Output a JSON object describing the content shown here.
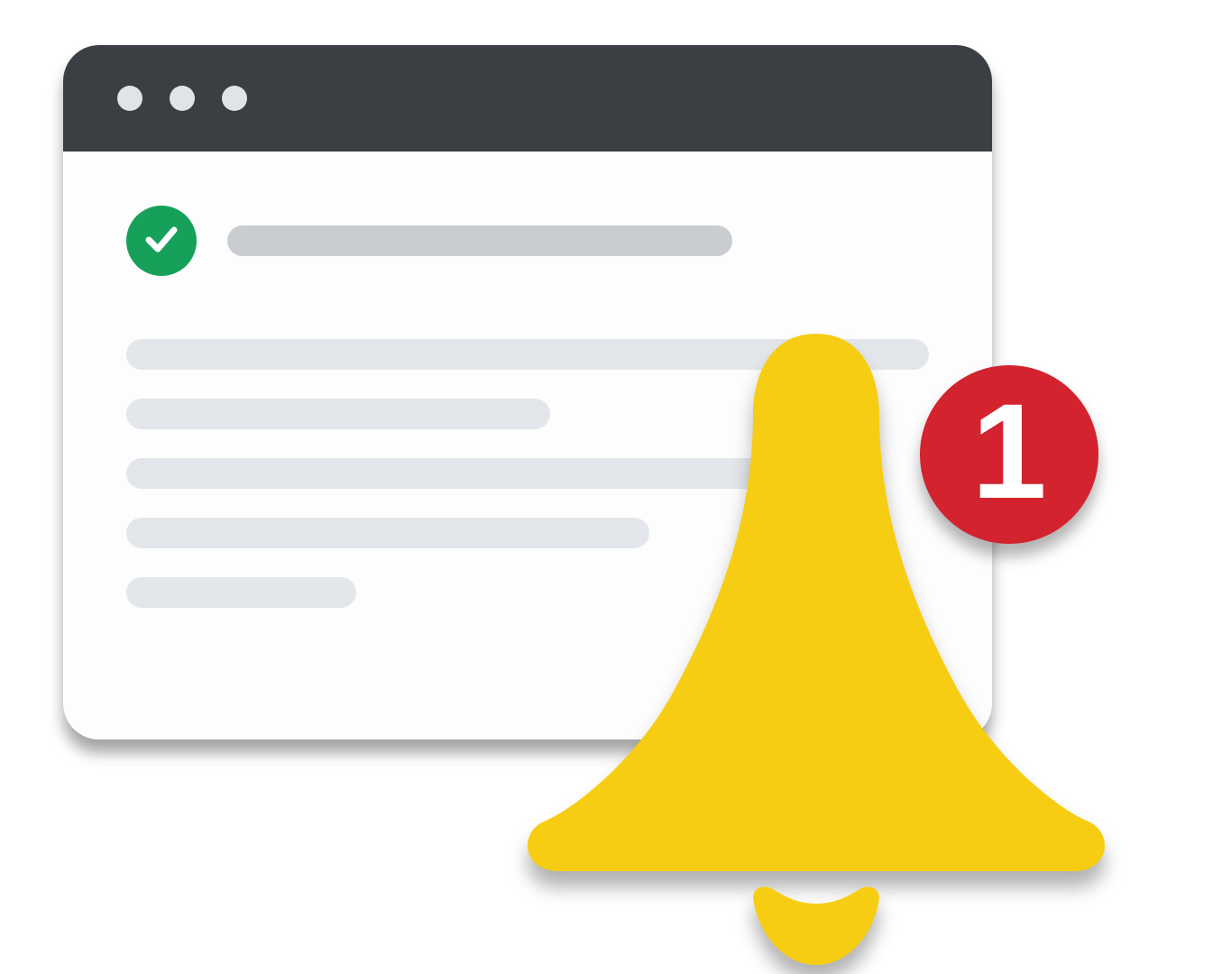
{
  "colors": {
    "titlebar": "#3b3f44",
    "window_bg": "#fdfdfd",
    "dot": "#e0e3e7",
    "check_badge": "#16a05a",
    "heading_bar": "#c9ccd0",
    "body_line": "#e3e6ea",
    "bell": "#f7cd13",
    "badge_bg": "#d3232f",
    "badge_fg": "#ffffff"
  },
  "window": {
    "traffic_light_count": 3
  },
  "icons": {
    "check": "checkmark-icon",
    "bell": "bell-icon"
  },
  "notification": {
    "count": "1"
  }
}
